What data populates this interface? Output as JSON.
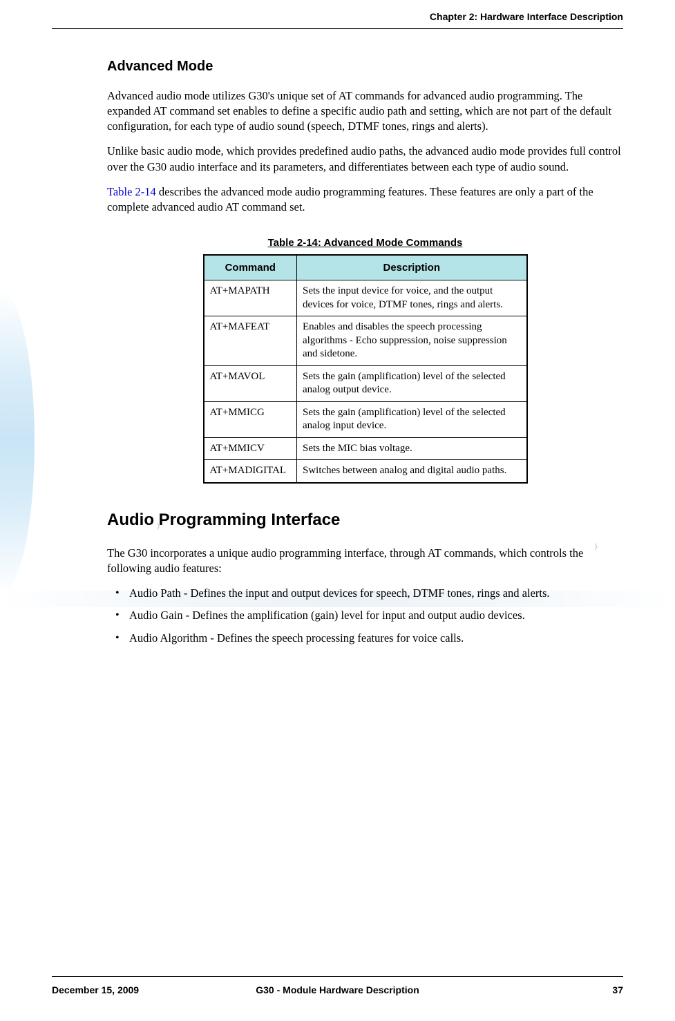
{
  "header": {
    "chapter": "Chapter 2:  Hardware Interface Description"
  },
  "section1": {
    "title": "Advanced Mode",
    "p1": "Advanced audio mode utilizes G30's unique set of AT commands for advanced audio programming. The expanded AT command set enables to define a specific audio path and setting, which are not part of the default configuration, for each type of audio sound (speech, DTMF tones, rings and alerts).",
    "p2": "Unlike basic audio mode, which provides predefined audio paths, the advanced audio mode provides full control over the G30 audio interface and its parameters, and differentiates between each type of audio sound.",
    "p3a": "Table 2-14",
    "p3b": " describes the advanced mode audio programming features. These features are only a part of the complete advanced audio AT command set."
  },
  "table": {
    "caption": "Table 2-14: Advanced Mode Commands ",
    "headers": {
      "col1": "Command",
      "col2": "Description"
    },
    "rows": [
      {
        "cmd": "AT+MAPATH",
        "desc": "Sets the input device for voice, and the output devices for voice, DTMF tones, rings and alerts."
      },
      {
        "cmd": "AT+MAFEAT",
        "desc": "Enables and disables the speech processing algorithms - Echo suppression, noise suppression and sidetone."
      },
      {
        "cmd": "AT+MAVOL",
        "desc": "Sets the gain (amplification) level of the selected analog output device."
      },
      {
        "cmd": "AT+MMICG",
        "desc": "Sets the gain (amplification) level of the selected analog input device."
      },
      {
        "cmd": "AT+MMICV",
        "desc": " Sets the MIC bias voltage."
      },
      {
        "cmd": "AT+MADIGITAL",
        "desc": "Switches between analog and digital audio paths."
      }
    ]
  },
  "section2": {
    "title": "Audio Programming Interface",
    "p1": "The G30 incorporates a unique audio programming interface, through AT commands, which controls the following audio features:",
    "bullets": [
      "Audio Path - Defines the input and output devices for speech, DTMF tones, rings and alerts.",
      "Audio Gain - Defines the amplification (gain) level for input and output audio devices.",
      "Audio Algorithm - Defines the speech processing features for voice calls."
    ]
  },
  "footer": {
    "date": "December 15, 2009",
    "title": "G30 - Module Hardware Description",
    "page": "37"
  }
}
